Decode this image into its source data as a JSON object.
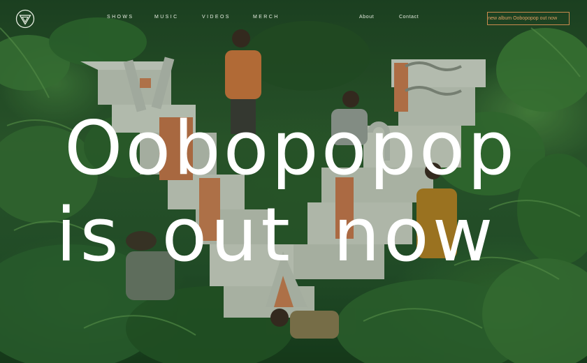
{
  "brand": {
    "logo_icon": "triangle-circle-logo-icon"
  },
  "nav": {
    "left": [
      {
        "label": "SHOWS"
      },
      {
        "label": "MUSIC"
      },
      {
        "label": "VIDEOS"
      },
      {
        "label": "MERCH"
      }
    ],
    "right": [
      {
        "label": "About"
      },
      {
        "label": "Contact"
      }
    ],
    "cta_label": "r new album Oobopopop out now"
  },
  "hero": {
    "line1": "Oobopopop",
    "line2": "is out now"
  },
  "colors": {
    "accent": "#e0a063",
    "text": "#ffffff",
    "jungle": "#2c5a2d"
  }
}
